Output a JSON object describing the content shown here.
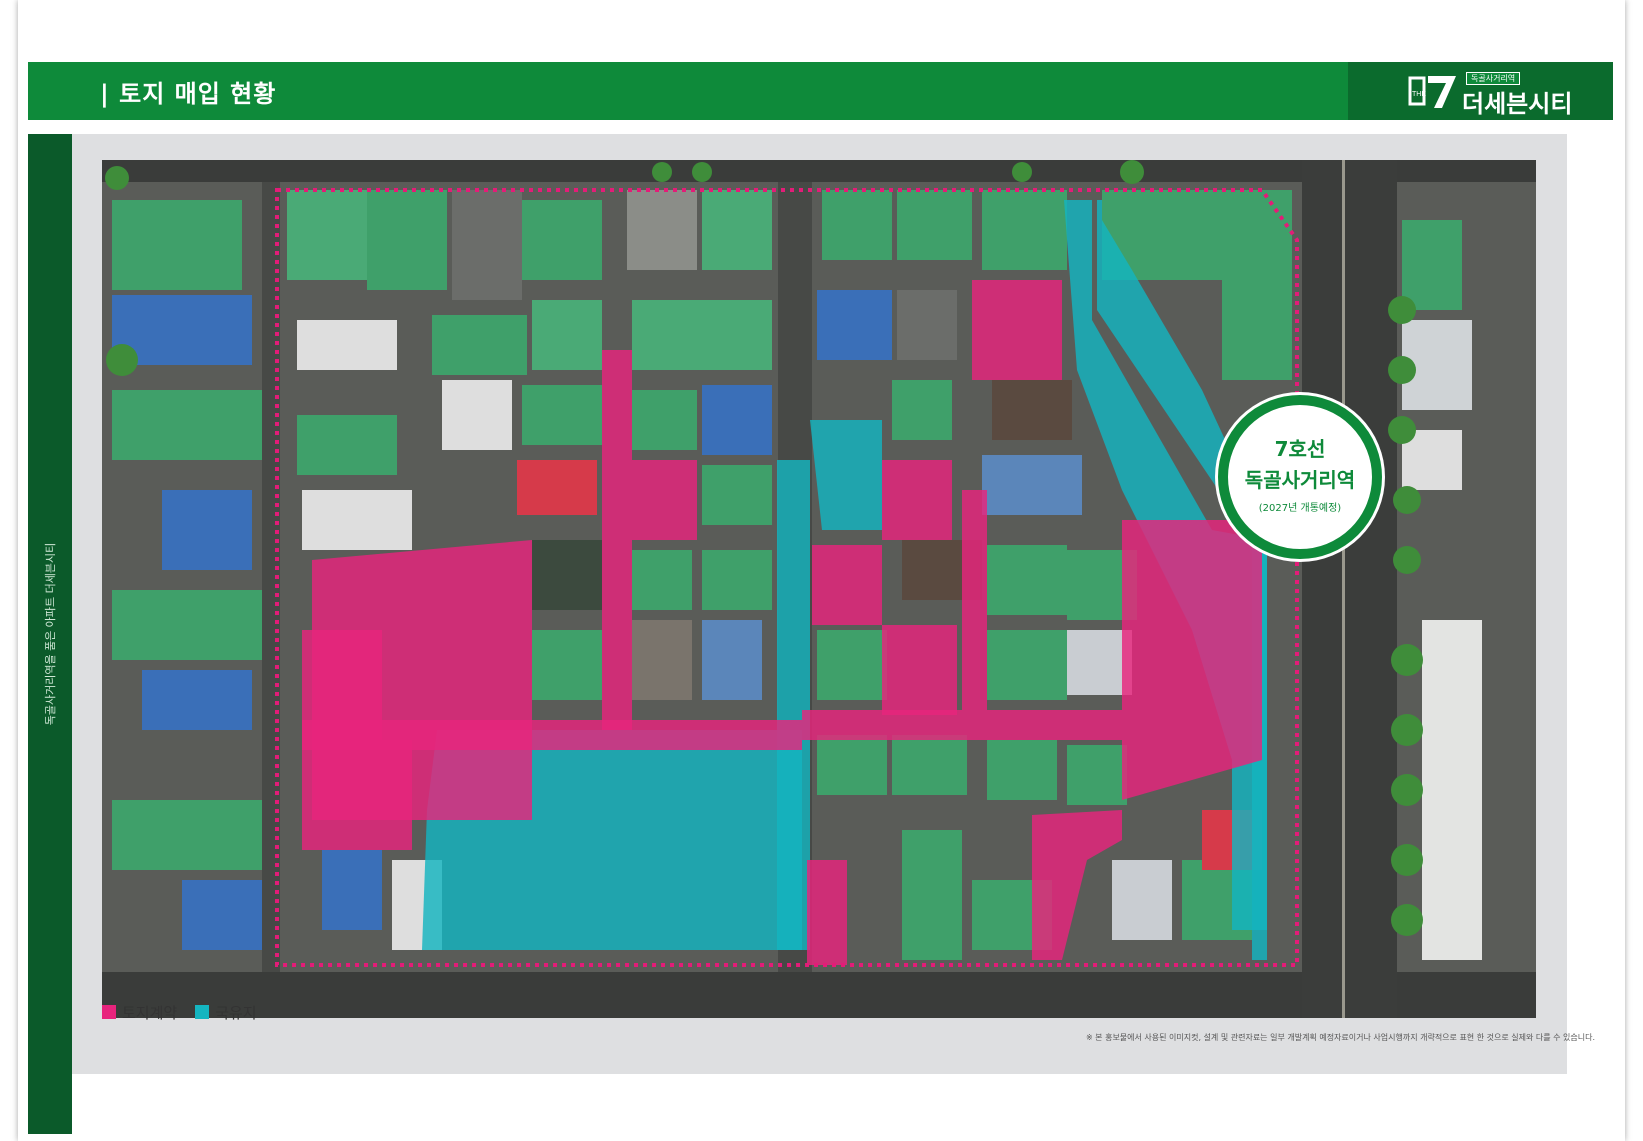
{
  "header": {
    "title": "| 토지 매입 현황",
    "brand_sub": "독골사거리역",
    "brand_name": "더세븐시티"
  },
  "side": {
    "caption": "독골사거리역을 품은 아파트 더세븐시티"
  },
  "station": {
    "line": "7호선",
    "name": "독골사거리역",
    "note": "(2027년 개통예정)"
  },
  "legend": [
    {
      "label": "토지계약",
      "color": "#e8247d"
    },
    {
      "label": "국유지",
      "color": "#14b5c0"
    }
  ],
  "colors": {
    "brand_green": "#0e8a3a",
    "dark_green": "#0b6b2d",
    "contract_pink": "#e8247d",
    "state_cyan": "#14b5c0",
    "boundary_dotted": "#e31c78"
  },
  "disclaimer": "※ 본 홍보물에서 사용된 이미지컷, 설계 및 관련자료는 일부 개발계획 예정자료이거나 사업시행까지 개략적으로 표현 한 것으로 실제와 다를 수 있습니다."
}
